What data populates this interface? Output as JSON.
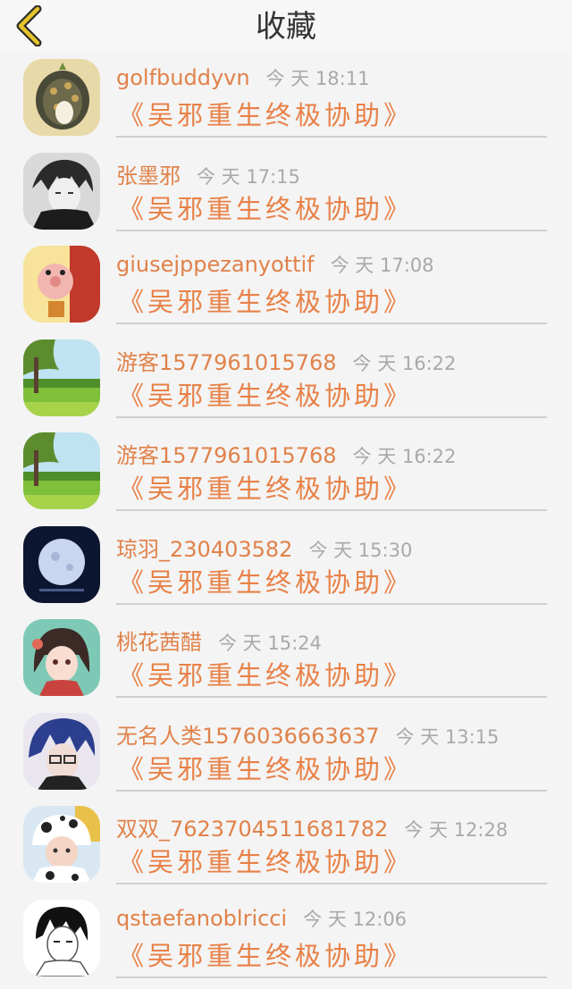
{
  "header": {
    "title": "收藏"
  },
  "colors": {
    "accent": "#e88147",
    "time": "#a9a9a9",
    "back_arrow": "#e6c42a"
  },
  "items": [
    {
      "name": "golfbuddyvn",
      "time": "今 天  18:11",
      "message": "《吴邪重生终极协助》",
      "avatar": "rabbit-hole-avatar"
    },
    {
      "name": "张墨邪",
      "time": "今 天  17:15",
      "message": "《吴邪重生终极协助》",
      "avatar": "anime-boy-grey-avatar"
    },
    {
      "name": "giusejppezanyottif",
      "time": "今 天  17:08",
      "message": "《吴邪重生终极协助》",
      "avatar": "cartoon-pig-avatar"
    },
    {
      "name": "游客1577961015768",
      "time": "今 天  16:22",
      "message": "《吴邪重生终极协助》",
      "avatar": "green-landscape-avatar"
    },
    {
      "name": "游客1577961015768",
      "time": "今 天  16:22",
      "message": "《吴邪重生终极协助》",
      "avatar": "green-landscape-avatar"
    },
    {
      "name": "琼羽_230403582",
      "time": "今 天  15:30",
      "message": "《吴邪重生终极协助》",
      "avatar": "moon-night-avatar"
    },
    {
      "name": "桃花茜醋",
      "time": "今 天  15:24",
      "message": "《吴邪重生终极协助》",
      "avatar": "anime-girl-avatar"
    },
    {
      "name": "无名人类1576036663637",
      "time": "今 天  13:15",
      "message": "《吴邪重生终极协助》",
      "avatar": "blue-hair-boy-avatar"
    },
    {
      "name": "双双_7623704511681782",
      "time": "今 天  12:28",
      "message": "《吴邪重生终极协助》",
      "avatar": "baby-cow-hat-avatar"
    },
    {
      "name": "qstaefanoblricci",
      "time": "今 天  12:06",
      "message": "《吴邪重生终极协助》",
      "avatar": "sketch-boy-avatar"
    }
  ]
}
